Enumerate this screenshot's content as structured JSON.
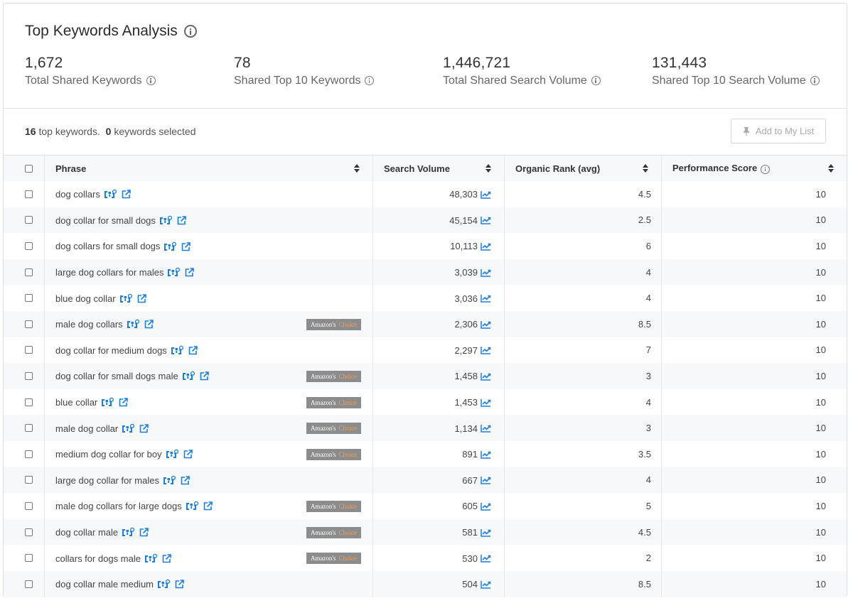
{
  "header": {
    "title": "Top Keywords Analysis",
    "stats": [
      {
        "value": "1,672",
        "label": "Total Shared Keywords"
      },
      {
        "value": "78",
        "label": "Shared Top 10 Keywords"
      },
      {
        "value": "1,446,721",
        "label": "Total Shared Search Volume"
      },
      {
        "value": "131,443",
        "label": "Shared Top 10 Search Volume"
      }
    ]
  },
  "toolbar": {
    "count": "16",
    "count_text": "top keywords.",
    "selected": "0",
    "selected_text": "keywords selected",
    "add_button_label": "Add to My List"
  },
  "table": {
    "columns": [
      "Phrase",
      "Search Volume",
      "Organic Rank (avg)",
      "Performance Score"
    ],
    "badge_prefix": "Amazon's",
    "badge_suffix": "Choice",
    "rows": [
      {
        "phrase": "dog collars",
        "volume": "48,303",
        "rank": "4.5",
        "score": "10",
        "amazons_choice": false
      },
      {
        "phrase": "dog collar for small dogs",
        "volume": "45,154",
        "rank": "2.5",
        "score": "10",
        "amazons_choice": false
      },
      {
        "phrase": "dog collars for small dogs",
        "volume": "10,113",
        "rank": "6",
        "score": "10",
        "amazons_choice": false
      },
      {
        "phrase": "large dog collars for males",
        "volume": "3,039",
        "rank": "4",
        "score": "10",
        "amazons_choice": false
      },
      {
        "phrase": "blue dog collar",
        "volume": "3,036",
        "rank": "4",
        "score": "10",
        "amazons_choice": false
      },
      {
        "phrase": "male dog collars",
        "volume": "2,306",
        "rank": "8.5",
        "score": "10",
        "amazons_choice": true
      },
      {
        "phrase": "dog collar for medium dogs",
        "volume": "2,297",
        "rank": "7",
        "score": "10",
        "amazons_choice": false
      },
      {
        "phrase": "dog collar for small dogs male",
        "volume": "1,458",
        "rank": "3",
        "score": "10",
        "amazons_choice": true
      },
      {
        "phrase": "blue collar",
        "volume": "1,453",
        "rank": "4",
        "score": "10",
        "amazons_choice": true
      },
      {
        "phrase": "male dog collar",
        "volume": "1,134",
        "rank": "3",
        "score": "10",
        "amazons_choice": true
      },
      {
        "phrase": "medium dog collar for boy",
        "volume": "891",
        "rank": "3.5",
        "score": "10",
        "amazons_choice": true
      },
      {
        "phrase": "large dog collar for males",
        "volume": "667",
        "rank": "4",
        "score": "10",
        "amazons_choice": false
      },
      {
        "phrase": "male dog collars for large dogs",
        "volume": "605",
        "rank": "5",
        "score": "10",
        "amazons_choice": true
      },
      {
        "phrase": "dog collar male",
        "volume": "581",
        "rank": "4.5",
        "score": "10",
        "amazons_choice": true
      },
      {
        "phrase": "collars for dogs male",
        "volume": "530",
        "rank": "2",
        "score": "10",
        "amazons_choice": true
      },
      {
        "phrase": "dog collar male medium",
        "volume": "504",
        "rank": "8.5",
        "score": "10",
        "amazons_choice": false
      }
    ]
  },
  "colors": {
    "accent": "#1a7fe0",
    "badge_bg": "#8c8c8c",
    "badge_choice": "#f0a050",
    "zebra": "#f7f8f9"
  },
  "icons": {
    "title_info": "info-icon",
    "keyword_search": "search-keyword-icon",
    "external": "external-link-icon",
    "trend": "trend-chart-icon",
    "pin": "pin-icon"
  }
}
